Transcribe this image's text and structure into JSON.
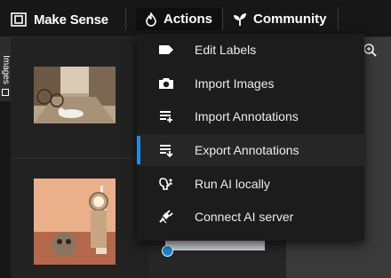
{
  "app": {
    "name": "Make Sense"
  },
  "nav": {
    "actions": "Actions",
    "community": "Community"
  },
  "sidebar": {
    "tab_label": "Images"
  },
  "menu": {
    "items": [
      {
        "label": "Edit Labels",
        "icon": "label-tag-icon"
      },
      {
        "label": "Import Images",
        "icon": "camera-icon"
      },
      {
        "label": "Import Annotations",
        "icon": "import-list-icon"
      },
      {
        "label": "Export Annotations",
        "icon": "export-list-icon"
      },
      {
        "label": "Run AI locally",
        "icon": "ai-brain-icon"
      },
      {
        "label": "Connect AI server",
        "icon": "plug-icon"
      }
    ],
    "hovered_index": 3
  },
  "colors": {
    "accent": "#1e8ce8",
    "check": "#1e88d6"
  }
}
